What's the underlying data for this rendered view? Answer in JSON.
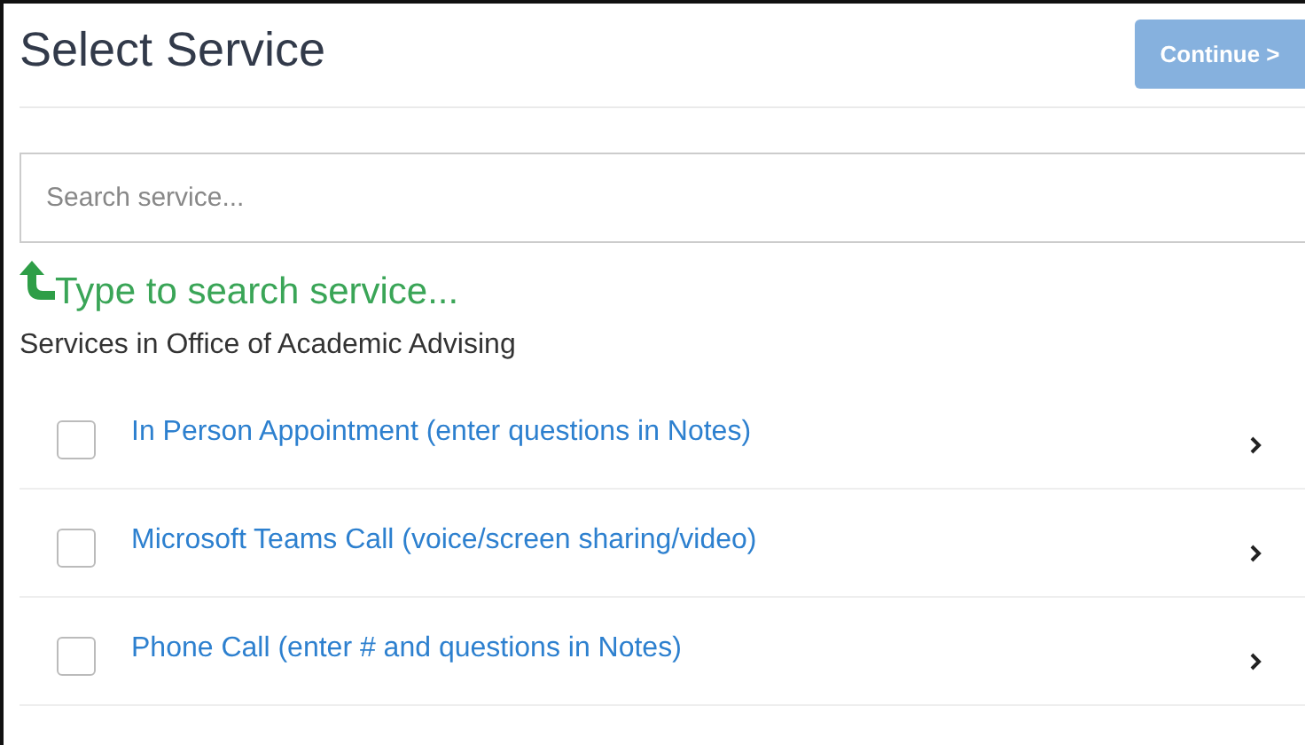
{
  "title": "Select Service",
  "continue_button": {
    "label": "Continue >",
    "disabled": true
  },
  "search": {
    "placeholder": "Search service..."
  },
  "hint": "Type to search service...",
  "section_heading": "Services in Office of Academic Advising",
  "services": [
    {
      "label": "In Person Appointment (enter questions in Notes)",
      "checked": false
    },
    {
      "label": "Microsoft Teams Call (voice/screen sharing/video)",
      "checked": false
    },
    {
      "label": "Phone Call (enter # and questions in Notes)",
      "checked": false
    }
  ]
}
